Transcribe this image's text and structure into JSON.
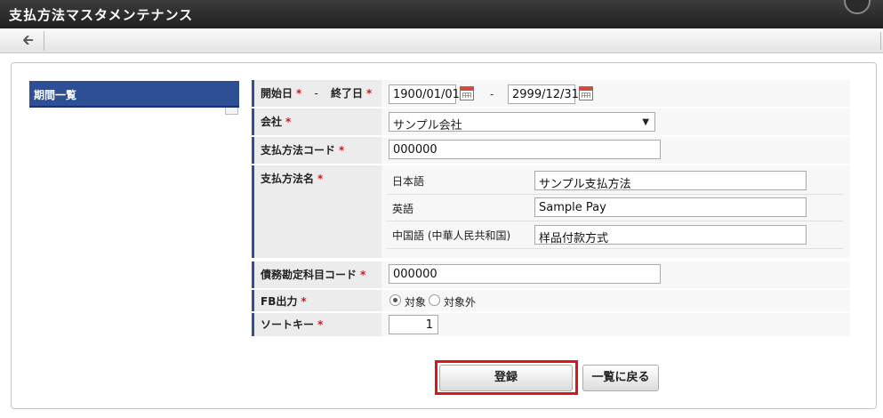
{
  "app": {
    "title": "支払方法マスタメンテナンス"
  },
  "toolbar": {
    "back_icon": "back-arrow-icon"
  },
  "sidebar": {
    "header": "期間一覧"
  },
  "form": {
    "period": {
      "start_label": "開始日",
      "dash1": "-",
      "end_label": "終了日",
      "start_value": "1900/01/01",
      "dash2": "-",
      "end_value": "2999/12/31"
    },
    "company": {
      "label": "会社",
      "value": "サンプル会社"
    },
    "code": {
      "label": "支払方法コード",
      "value": "000000"
    },
    "name": {
      "label": "支払方法名",
      "langs": [
        {
          "label": "日本語",
          "value": "サンプル支払方法"
        },
        {
          "label": "英語",
          "value": "Sample Pay"
        },
        {
          "label": "中国語 (中華人民共和国)",
          "value": "样品付款方式"
        }
      ]
    },
    "account_code": {
      "label": "債務勘定科目コード",
      "value": "000000"
    },
    "fb_output": {
      "label": "FB出力",
      "option_on": "対象",
      "option_off": "対象外",
      "selected": "対象"
    },
    "sort_key": {
      "label": "ソートキー",
      "value": "1"
    },
    "required_mark": "*"
  },
  "buttons": {
    "register": "登録",
    "back_to_list": "一覧に戻る"
  },
  "colors": {
    "accent": "#2f4f95",
    "required": "#d9161b",
    "highlight": "#d9161b"
  }
}
